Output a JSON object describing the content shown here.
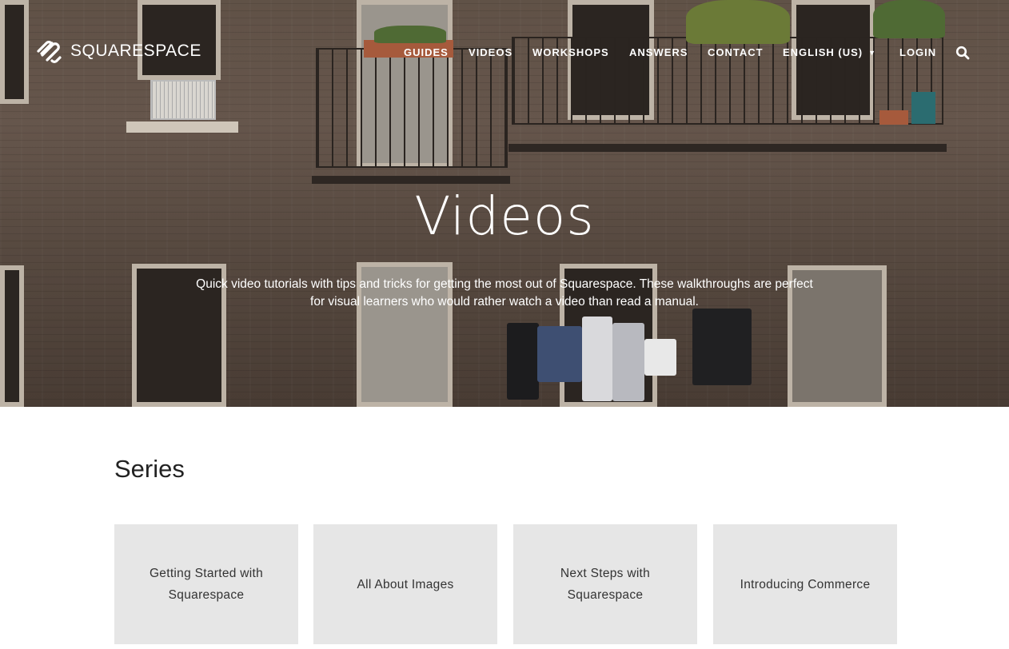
{
  "brand": {
    "name": "SQUARESPACE",
    "logo_icon": "squarespace-logo-icon"
  },
  "nav": {
    "items": [
      "GUIDES",
      "VIDEOS",
      "WORKSHOPS",
      "ANSWERS",
      "CONTACT"
    ],
    "language": "ENGLISH (US)",
    "login": "LOGIN",
    "search_icon": "search-icon"
  },
  "hero": {
    "title": "Videos",
    "description": "Quick video tutorials with tips and tricks for getting the most out of Squarespace. These walkthroughs are perfect for visual learners who would rather watch a video than read a manual."
  },
  "series": {
    "title": "Series",
    "cards": [
      "Getting Started with Squarespace",
      "All About Images",
      "Next Steps with Squarespace",
      "Introducing Commerce"
    ]
  },
  "colors": {
    "card_bg": "#e6e6e6",
    "text_dark": "#222222",
    "hero_text": "#ffffff"
  }
}
